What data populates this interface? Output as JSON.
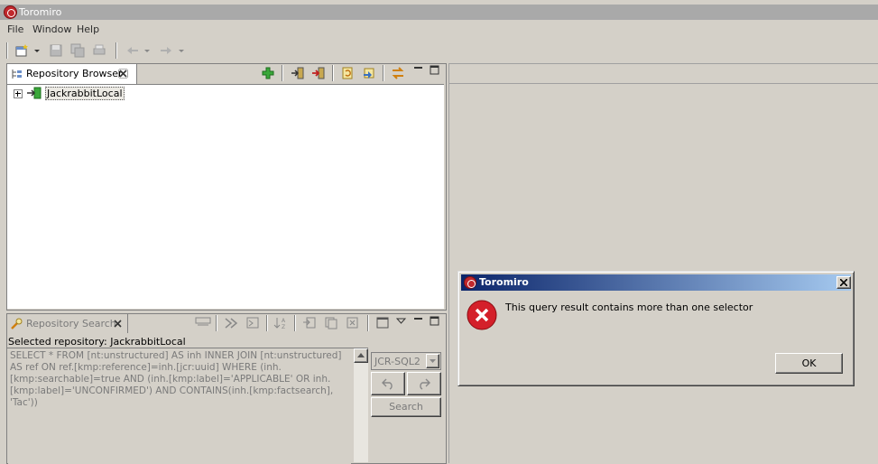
{
  "window": {
    "title": "Toromiro"
  },
  "menu": {
    "items": [
      "File",
      "Window",
      "Help"
    ]
  },
  "repository_browser": {
    "tab_label": "Repository Browser",
    "tree": [
      {
        "label": "JackrabbitLocal",
        "expanded": false
      }
    ]
  },
  "repository_search": {
    "tab_label": "Repository Search",
    "selected_repository": "Selected repository: JackrabbitLocal",
    "query": "SELECT * FROM [nt:unstructured] AS inh INNER JOIN [nt:unstructured] AS ref ON ref.[kmp:reference]=inh.[jcr:uuid] WHERE (inh.[kmp:searchable]=true AND (inh.[kmp:label]='APPLICABLE' OR inh.[kmp:label]='UNCONFIRMED') AND CONTAINS(inh.[kmp:factsearch], 'Tac'))",
    "language": "JCR-SQL2",
    "search_label": "Search"
  },
  "dialog": {
    "title": "Toromiro",
    "message": "This query result contains more than one selector",
    "ok_label": "OK",
    "icon": "error-icon"
  },
  "colors": {
    "dialog_title_start": "#0a246a",
    "dialog_title_end": "#a6caf0",
    "error_red": "#d4202a"
  }
}
